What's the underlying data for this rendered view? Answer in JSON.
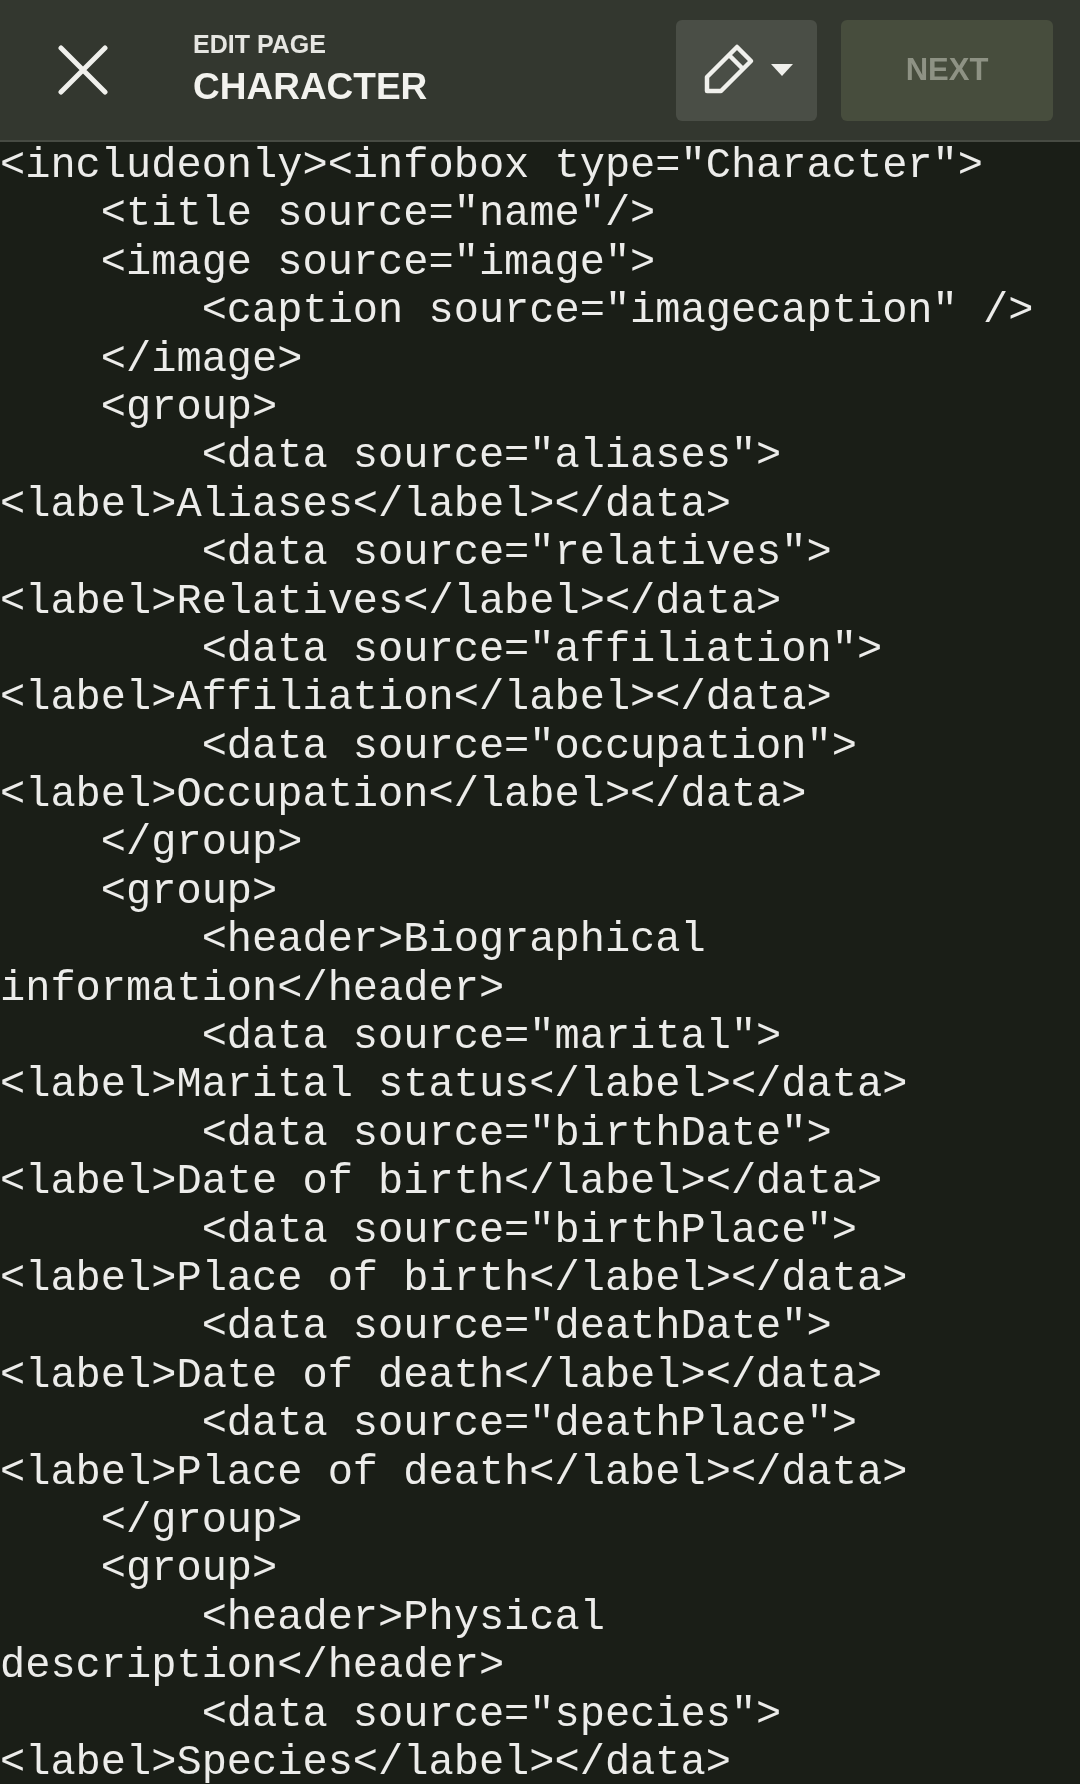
{
  "header": {
    "subtitle": "EDIT PAGE",
    "title": "CHARACTER",
    "next_button": {
      "label": "NEXT",
      "disabled": true
    }
  },
  "editor": {
    "lines": [
      "<includeonly><infobox type=\"Character\">",
      "    <title source=\"name\"/>",
      "    <image source=\"image\">",
      "        <caption source=\"imagecaption\" />",
      "    </image>",
      "    <group>",
      "        <data source=\"aliases\">",
      "<label>Aliases</label></data>",
      "        <data source=\"relatives\">",
      "<label>Relatives</label></data>",
      "        <data source=\"affiliation\">",
      "<label>Affiliation</label></data>",
      "        <data source=\"occupation\">",
      "<label>Occupation</label></data>",
      "    </group>",
      "    <group>",
      "        <header>Biographical",
      "information</header>",
      "        <data source=\"marital\">",
      "<label>Marital status</label></data>",
      "        <data source=\"birthDate\">",
      "<label>Date of birth</label></data>",
      "        <data source=\"birthPlace\">",
      "<label>Place of birth</label></data>",
      "        <data source=\"deathDate\">",
      "<label>Date of death</label></data>",
      "        <data source=\"deathPlace\">",
      "<label>Place of death</label></data>",
      "    </group>",
      "    <group>",
      "        <header>Physical",
      "description</header>",
      "        <data source=\"species\">",
      "<label>Species</label></data>"
    ]
  }
}
